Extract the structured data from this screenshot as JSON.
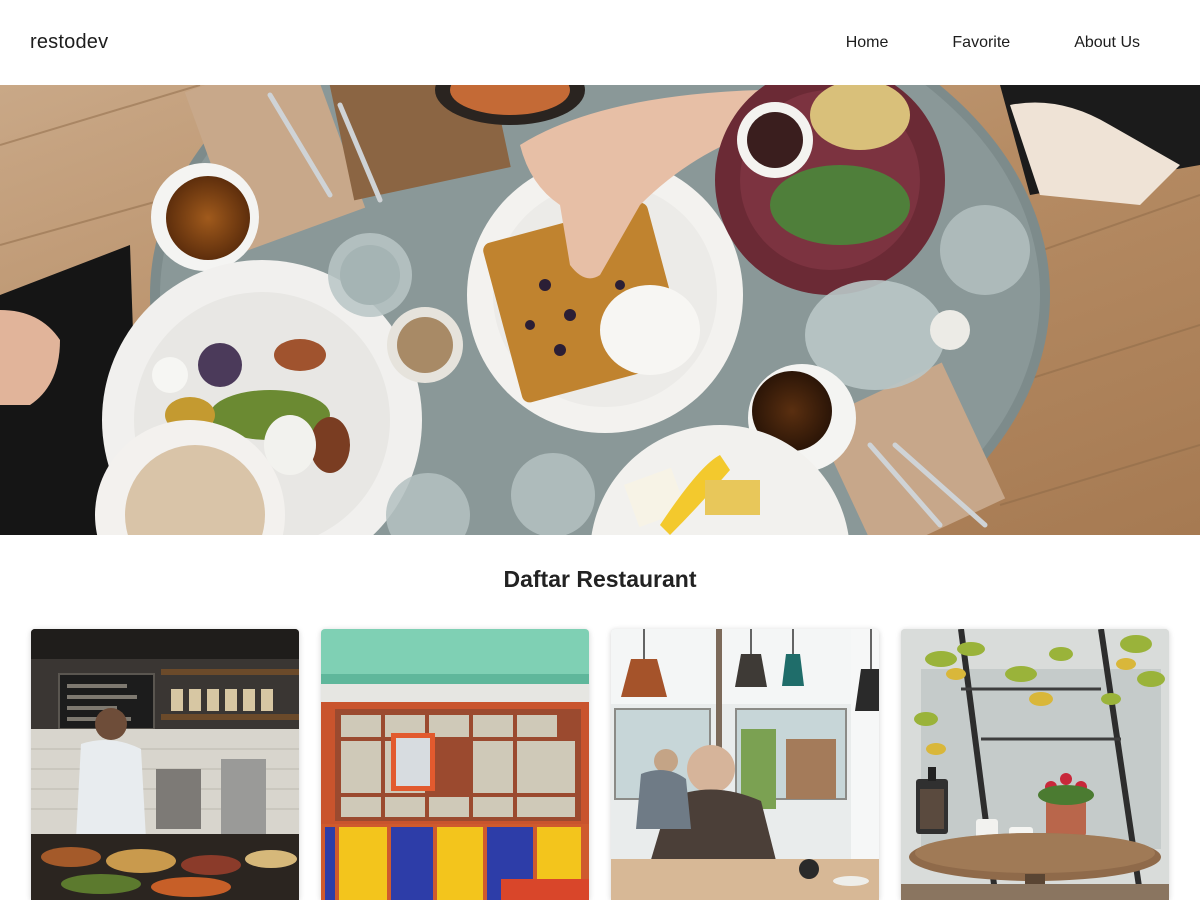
{
  "header": {
    "brand": "restodev",
    "nav": [
      {
        "label": "Home"
      },
      {
        "label": "Favorite"
      },
      {
        "label": "About Us"
      }
    ]
  },
  "hero": {
    "image": "hero-food-table-photo"
  },
  "main": {
    "title": "Daftar Restaurant",
    "restaurants": [
      {
        "image": "cafe-counter-barista-photo"
      },
      {
        "image": "colorful-storefront-photo"
      },
      {
        "image": "cafe-interior-pendant-lamps-photo"
      },
      {
        "image": "cafe-table-window-plant-photo"
      }
    ]
  }
}
